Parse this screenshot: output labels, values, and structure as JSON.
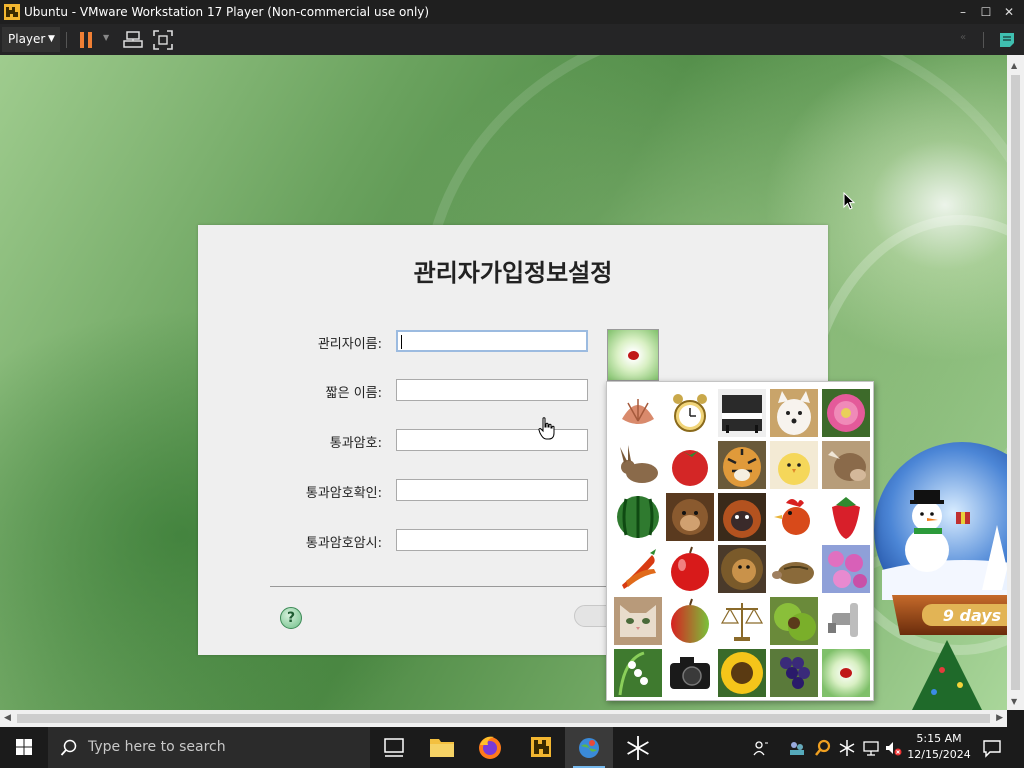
{
  "window": {
    "title": "Ubuntu - VMware Workstation 17 Player (Non-commercial use only)",
    "player_menu": "Player",
    "controls": {
      "minimize": "–",
      "maximize": "☐",
      "close": "✕"
    }
  },
  "dialog": {
    "heading": "관리자가입정보설정",
    "fields": [
      {
        "label": "관리자이름:",
        "value": ""
      },
      {
        "label": "짧은 이름:",
        "value": ""
      },
      {
        "label": "통과암호:",
        "value": ""
      },
      {
        "label": "통과암호확인:",
        "value": ""
      },
      {
        "label": "통과암호암시:",
        "value": ""
      }
    ],
    "help_label": "?"
  },
  "picture_picker": {
    "pictures": [
      "shell",
      "alarm-clock",
      "piano",
      "white-dog",
      "pink-flower",
      "rabbit",
      "tomato",
      "tiger",
      "chick",
      "cow",
      "watermelon",
      "monkey",
      "orangutan",
      "rooster",
      "strawberry",
      "chili-pepper",
      "red-apple",
      "lion",
      "tortoise",
      "lilac-flowers",
      "cat",
      "green-red-apple",
      "scales",
      "chestnuts",
      "faucet",
      "lily-of-the-valley",
      "camera",
      "sunflower",
      "grapes",
      "ladybug"
    ]
  },
  "gadget": {
    "countdown": "9 days"
  },
  "taskbar": {
    "search_placeholder": "Type here to search",
    "time": "5:15 AM",
    "date": "12/15/2024"
  },
  "colors": {
    "titlebar": "#1f1f1f",
    "toolbar": "#252526",
    "pause": "#f07f34",
    "accent_teal": "#3fbfb0",
    "taskbar": "#1b1b1b"
  }
}
